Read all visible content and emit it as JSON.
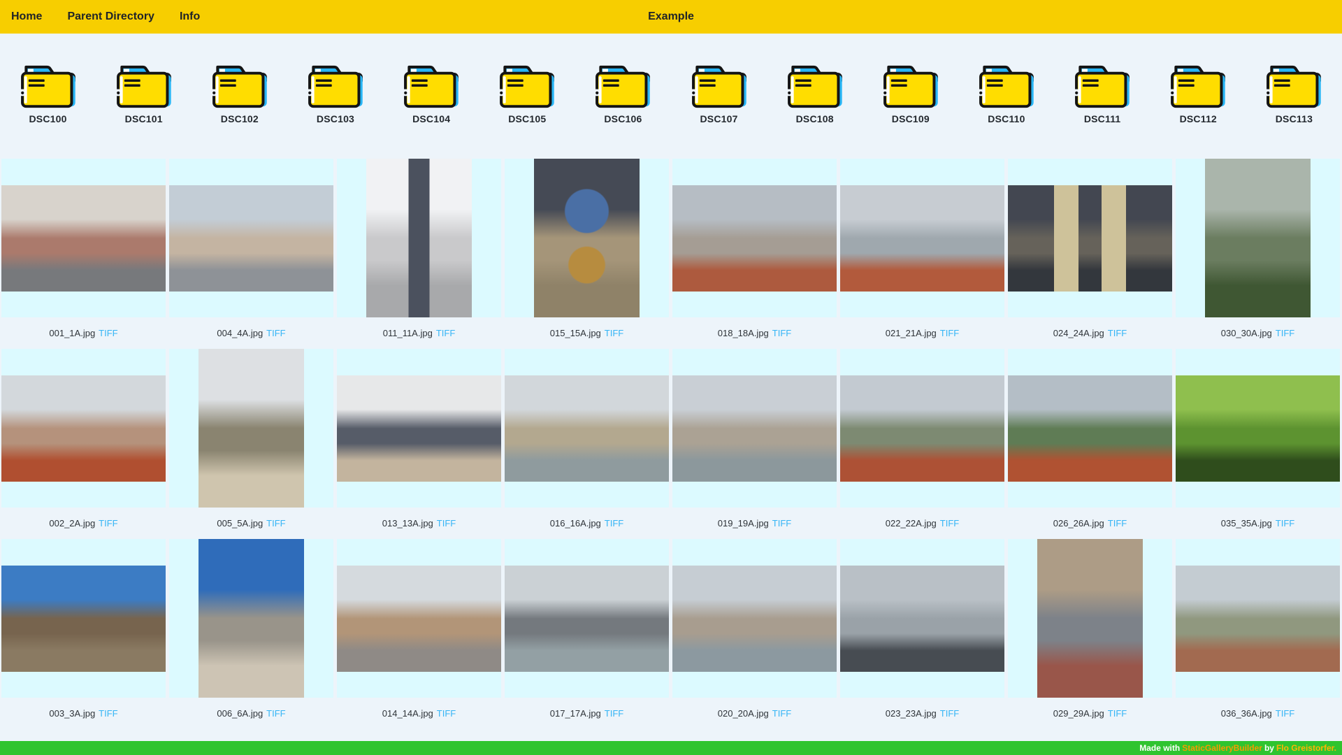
{
  "topbar": {
    "bg": "#F7CE00",
    "title": "Example",
    "nav": [
      {
        "label": "Home"
      },
      {
        "label": "Parent Directory"
      },
      {
        "label": "Info"
      }
    ]
  },
  "folders": {
    "items": [
      "DSC100",
      "DSC101",
      "DSC102",
      "DSC103",
      "DSC104",
      "DSC105",
      "DSC106",
      "DSC107",
      "DSC108",
      "DSC109",
      "DSC110",
      "DSC111",
      "DSC112",
      "DSC113"
    ],
    "icon_colors": {
      "body": "#FFDD00",
      "tab": "#29B6F6",
      "accent": "#46C242",
      "outline": "#141414",
      "highlight": "#FFFFFF"
    }
  },
  "gallery": {
    "tiff_label": "TIFF",
    "cell_bg": "#DCFAFF",
    "tiff_color": "#35B5F5",
    "rows": [
      [
        {
          "file": "001_1A.jpg",
          "orientation": "landscape",
          "palette": [
            "#d8d3cc",
            "#ab7a6c",
            "#77797c"
          ]
        },
        {
          "file": "004_4A.jpg",
          "orientation": "landscape",
          "palette": [
            "#c3cdd6",
            "#c4b4a2",
            "#8e9297"
          ]
        },
        {
          "file": "011_11A.jpg",
          "orientation": "portrait",
          "palette": [
            "#f1f2f4",
            "#c9c9cb",
            "#a8a9ab"
          ],
          "overlay": {
            "type": "vband",
            "color": "#4b515e"
          }
        },
        {
          "file": "015_15A.jpg",
          "orientation": "portrait",
          "palette": [
            "#454a55",
            "#a59579",
            "#8f8268"
          ],
          "overlay": {
            "type": "circles",
            "colors": [
              "#4a6fa5",
              "#b78c3f"
            ]
          }
        },
        {
          "file": "018_18A.jpg",
          "orientation": "landscape",
          "palette": [
            "#b6bdc4",
            "#a59d94",
            "#ad5a3e"
          ]
        },
        {
          "file": "021_21A.jpg",
          "orientation": "landscape",
          "palette": [
            "#c7ccd2",
            "#9fa8ae",
            "#b25a3c"
          ]
        },
        {
          "file": "024_24A.jpg",
          "orientation": "landscape",
          "palette": [
            "#434751",
            "#66625a",
            "#33373d"
          ],
          "overlay": {
            "type": "vband2",
            "color": "#cec29a"
          }
        },
        {
          "file": "030_30A.jpg",
          "orientation": "portrait",
          "palette": [
            "#aab5ab",
            "#6b7d60",
            "#3f5733"
          ]
        }
      ],
      [
        {
          "file": "002_2A.jpg",
          "orientation": "landscape",
          "palette": [
            "#d3d8dc",
            "#b5927c",
            "#b04f30"
          ]
        },
        {
          "file": "005_5A.jpg",
          "orientation": "portrait",
          "palette": [
            "#dde0e3",
            "#8a8470",
            "#cfc5ae"
          ]
        },
        {
          "file": "013_13A.jpg",
          "orientation": "landscape",
          "palette": [
            "#e7e8e9",
            "#565c68",
            "#c3b49e"
          ]
        },
        {
          "file": "016_16A.jpg",
          "orientation": "landscape",
          "palette": [
            "#d2d7db",
            "#b3a88f",
            "#8f9b9e"
          ]
        },
        {
          "file": "019_19A.jpg",
          "orientation": "landscape",
          "palette": [
            "#c9cfd5",
            "#aba294",
            "#8c989c"
          ]
        },
        {
          "file": "022_22A.jpg",
          "orientation": "landscape",
          "palette": [
            "#c3cad1",
            "#7d8a72",
            "#ad5135"
          ]
        },
        {
          "file": "026_26A.jpg",
          "orientation": "landscape",
          "palette": [
            "#b4bec6",
            "#5f7c55",
            "#b05232"
          ]
        },
        {
          "file": "035_35A.jpg",
          "orientation": "landscape",
          "palette": [
            "#8fbf4e",
            "#5d9330",
            "#2f4d1c"
          ]
        }
      ],
      [
        {
          "file": "003_3A.jpg",
          "orientation": "landscape",
          "palette": [
            "#3c7cc4",
            "#77644e",
            "#8a7a62"
          ]
        },
        {
          "file": "006_6A.jpg",
          "orientation": "portrait",
          "palette": [
            "#2f6cba",
            "#99948a",
            "#cdc4b4"
          ]
        },
        {
          "file": "014_14A.jpg",
          "orientation": "landscape",
          "palette": [
            "#d5dade",
            "#b29578",
            "#8f8a86"
          ]
        },
        {
          "file": "017_17A.jpg",
          "orientation": "landscape",
          "palette": [
            "#cbd1d5",
            "#74797e",
            "#93a0a4"
          ]
        },
        {
          "file": "020_20A.jpg",
          "orientation": "landscape",
          "palette": [
            "#c6cdd3",
            "#a89d8f",
            "#8c99a0"
          ]
        },
        {
          "file": "023_23A.jpg",
          "orientation": "landscape",
          "palette": [
            "#b9c0c6",
            "#9aa2a8",
            "#474c52"
          ]
        },
        {
          "file": "029_29A.jpg",
          "orientation": "portrait",
          "palette": [
            "#ad9c86",
            "#7d8289",
            "#99564a"
          ]
        },
        {
          "file": "036_36A.jpg",
          "orientation": "landscape",
          "palette": [
            "#c4ccd2",
            "#90987f",
            "#a26a50"
          ]
        }
      ]
    ]
  },
  "footer": {
    "bg": "#2FC42F",
    "made_with": "Made with",
    "builder_link": "StaticGalleryBuilder",
    "by": "by",
    "author_link": "Flo Greistorfer.",
    "builder_color": "#F59B00",
    "author_color": "#FFB404"
  }
}
